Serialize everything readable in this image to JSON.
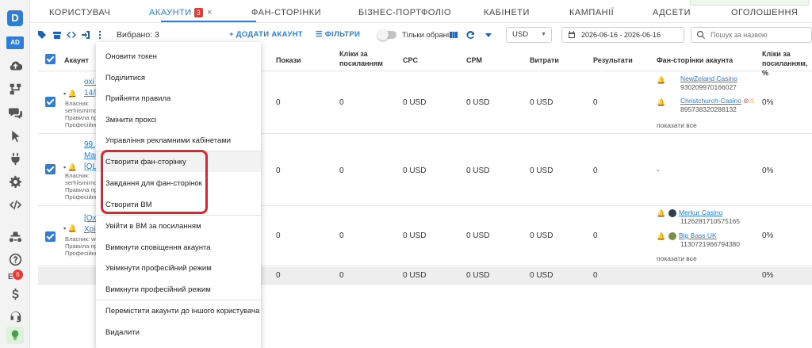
{
  "sidebar": {
    "logo": "D",
    "ad_label": "AD",
    "badge_count": "6",
    "e_label": "E",
    "icons": [
      "logo-icon",
      "ad-icon",
      "cloud-upload-icon",
      "sitemap-icon",
      "comments-icon",
      "pointer-icon",
      "plug-icon",
      "gear-icon",
      "code-icon",
      "spy-icon",
      "help-icon",
      "dollar-icon",
      "headset-icon",
      "bulb-icon"
    ]
  },
  "tabs": {
    "items": [
      {
        "label": "КОРИСТУВАЧ"
      },
      {
        "label": "АКАУНТИ"
      },
      {
        "label": "ФАН-СТОРІНКИ"
      },
      {
        "label": "БІЗНЕС-ПОРТФОЛІО"
      },
      {
        "label": "КАБІНЕТИ"
      },
      {
        "label": "КАМПАНІЇ"
      },
      {
        "label": "АДСЕТИ"
      },
      {
        "label": "ОГОЛОШЕННЯ"
      }
    ],
    "active_badge": "3",
    "close": "×"
  },
  "toolbar": {
    "selected": "Вибрано: 3",
    "add_account": "+ ДОДАТИ АКАУНТ",
    "filters": "ФІЛЬТРИ",
    "only_selected": "Тільки обрані",
    "currency": "USD",
    "date_range": "2026-06-16 - 2026-06-16",
    "search_placeholder": "Пошук за назвою"
  },
  "table": {
    "headers": {
      "account": "Акаунт",
      "impressions": "Покази",
      "clicks": "Кліки за посиланням",
      "cpc": "CPC",
      "cpm": "CPM",
      "spend": "Витрати",
      "results": "Результати",
      "fanpages": "Фан-сторінки акаунта",
      "clicks2": "Кліки за посиланням, %"
    },
    "rows": [
      {
        "name_line1": "oxi [",
        "name_line2": "14/[",
        "meta": [
          "Власник:",
          "serhiismirnov",
          "Правила при",
          "Професійний"
        ],
        "impressions": "0",
        "clicks": "0",
        "cpc": "0 USD",
        "cpm": "0 USD",
        "spend": "0 USD",
        "results": "0",
        "fanpages": [
          {
            "name": "NewZeland Casino",
            "id": "930209970166027"
          },
          {
            "name": "Christchurch-Casino",
            "id": "895738320288132"
          }
        ],
        "show_all": "показати все",
        "ctr": "0%"
      },
      {
        "name_line1": "99.",
        "name_line2": "Mar",
        "name_line3": "[QL[",
        "meta": [
          "Власник:",
          "serhiismirnov",
          "Правила при",
          "Професійний"
        ],
        "impressions": "0",
        "clicks": "0",
        "cpc": "0 USD",
        "cpm": "0 USD",
        "spend": "0 USD",
        "results": "0",
        "fanpages_empty": "-",
        "ctr": "0%"
      },
      {
        "name_line1": "[Охо",
        "name_line2": "Хрі",
        "meta": [
          "Власник: wo",
          "Правила при",
          "Професійний"
        ],
        "impressions": "0",
        "clicks": "0",
        "cpc": "0 USD",
        "cpm": "0 USD",
        "spend": "0 USD",
        "results": "0",
        "fanpages": [
          {
            "name": "Merkur Casino",
            "id": "1126281710575165"
          },
          {
            "name": "Big Bass UK",
            "id": "1130721966794380"
          }
        ],
        "show_all": "показати все",
        "ctr": "0%"
      }
    ],
    "totals": {
      "impressions": "0",
      "clicks": "0",
      "cpc": "0 USD",
      "cpm": "0 USD",
      "spend": "0 USD",
      "results": "0",
      "ctr": "0%"
    }
  },
  "menu": {
    "items": [
      "Оновити токен",
      "Поділитися",
      "Прийняти правила",
      "Змінити проксі",
      "Управління рекламними кабінетами",
      "Створити фан-сторінку",
      "Завдання для фан-сторінок",
      "Створити ВМ",
      "Увійти в ВМ за посиланням",
      "Вимкнути сповіщення акаунта",
      "Увімкнути професійний режим",
      "Вимкнути професійний режим",
      "Перемістити акаунти до іншого користувача",
      "Видалити"
    ]
  },
  "colors": {
    "accent": "#2e7dd7",
    "highlight": "#e3232c",
    "badge": "#e53935"
  }
}
